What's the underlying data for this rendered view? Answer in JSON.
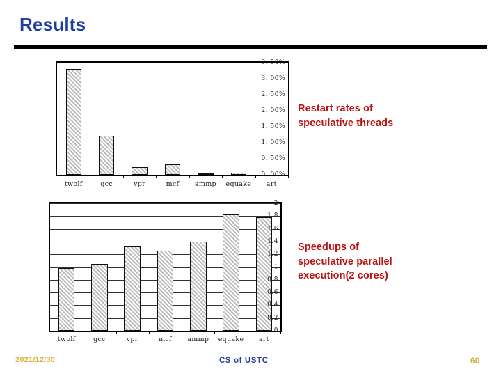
{
  "slide": {
    "title": "Results"
  },
  "annotations": {
    "chart1_caption": "Restart rates of\nspeculative threads",
    "chart2_caption": "Speedups of\nspeculative parallel\nexecution(2 cores)"
  },
  "footer": {
    "date": "2021/12/30",
    "center": "CS of USTC",
    "page": "60",
    "date_color": "#d6b33c",
    "center_color": "#1f3d9e",
    "page_color": "#d6b33c"
  },
  "colors": {
    "title": "#1f3d9e",
    "rule": "#000000",
    "callout": "#b81414",
    "bar_fill": "#d4d4d4",
    "bar_border": "#111111",
    "gridline": "#333333"
  },
  "chart_data": [
    {
      "type": "bar",
      "title": "Restart rates of speculative threads",
      "xlabel": "",
      "ylabel": "",
      "categories": [
        "twolf",
        "gcc",
        "vpr",
        "mcf",
        "ammp",
        "equake",
        "art"
      ],
      "values": [
        3.3,
        1.21,
        0.24,
        0.32,
        0.02,
        0.07,
        0.0
      ],
      "value_unit": "%",
      "ylim": [
        0.0,
        3.5
      ],
      "ytick_labels": [
        "0. 00%",
        "0. 50%",
        "1. 00%",
        "1. 50%",
        "2. 00%",
        "2. 50%",
        "3. 00%",
        "3. 50%"
      ],
      "ytick_values": [
        0.0,
        0.5,
        1.0,
        1.5,
        2.0,
        2.5,
        3.0,
        3.5
      ],
      "grid": true,
      "legend": "none"
    },
    {
      "type": "bar",
      "title": "Speedups of speculative parallel execution(2 cores)",
      "xlabel": "",
      "ylabel": "",
      "categories": [
        "twolf",
        "gcc",
        "vpr",
        "mcf",
        "ammp",
        "equake",
        "art"
      ],
      "values": [
        0.98,
        1.05,
        1.32,
        1.26,
        1.4,
        1.83,
        1.78
      ],
      "value_unit": "",
      "ylim": [
        0,
        2
      ],
      "ytick_labels": [
        "0",
        "0.2",
        "0.4",
        "0.6",
        "0.8",
        "1",
        "1.2",
        "1.4",
        "1.6",
        "1.8",
        "2"
      ],
      "ytick_values": [
        0,
        0.2,
        0.4,
        0.6,
        0.8,
        1.0,
        1.2,
        1.4,
        1.6,
        1.8,
        2.0
      ],
      "grid": true,
      "legend": "none"
    }
  ]
}
